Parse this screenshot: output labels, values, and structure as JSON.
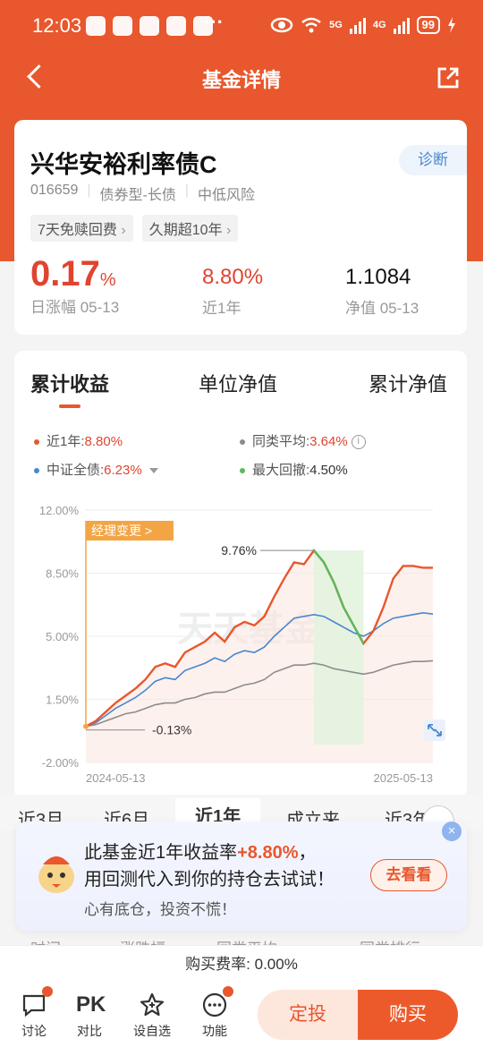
{
  "status": {
    "time": "12:03",
    "battery": "99",
    "net1": "5G",
    "net2": "4G",
    "more": "···"
  },
  "nav": {
    "title": "基金详情"
  },
  "fund": {
    "name": "兴华安裕利率债C",
    "code": "016659",
    "type": "债券型-长债",
    "risk": "中低风险",
    "diagnose": "诊断",
    "tags": [
      "7天免赎回费",
      "久期超10年"
    ],
    "day_change": "0.17",
    "day_change_unit": "%",
    "day_change_label": "日涨幅 05-13",
    "year_return": "8.80%",
    "year_return_label": "近1年",
    "nav_value": "1.1084",
    "nav_label": "净值 05-13"
  },
  "chart_tabs": [
    "累计收益",
    "单位净值",
    "累计净值"
  ],
  "legend": {
    "fund_label": "近1年:",
    "fund_value": "8.80%",
    "avg_label": "同类平均:",
    "avg_value": "3.64%",
    "index_label": "中证全债:",
    "index_value": "6.23%",
    "drawdown_label": "最大回撤:",
    "drawdown_value": "4.50%"
  },
  "chart_data": {
    "type": "line",
    "y_ticks": [
      "12.00%",
      "8.50%",
      "5.00%",
      "1.50%",
      "-2.00%"
    ],
    "ylim": [
      -2.0,
      12.0
    ],
    "x_ticks": [
      "2024-05-13",
      "2025-05-13"
    ],
    "watermark": "天天基金",
    "annotation_manager": "经理变更 >",
    "annotation_max": "9.76%",
    "annotation_min": "-0.13%",
    "series": [
      {
        "values": [
          0.0,
          0.3,
          0.8,
          1.3,
          1.7,
          2.1,
          2.6,
          3.3,
          3.5,
          3.3,
          4.1,
          4.4,
          4.7,
          5.2,
          4.7,
          5.5,
          5.8,
          5.6,
          6.1,
          7.2,
          8.2,
          9.1,
          9.0,
          9.76,
          9.1,
          8.0,
          6.6,
          5.6,
          4.6,
          5.3,
          6.6,
          8.2,
          8.9,
          8.9,
          8.8,
          8.8
        ]
      },
      {
        "values": [
          0.0,
          0.2,
          0.6,
          1.0,
          1.3,
          1.6,
          2.0,
          2.5,
          2.7,
          2.6,
          3.1,
          3.3,
          3.5,
          3.8,
          3.6,
          4.0,
          4.2,
          4.1,
          4.4,
          5.0,
          5.5,
          6.0,
          6.1,
          6.2,
          6.1,
          5.8,
          5.5,
          5.2,
          5.0,
          5.3,
          5.7,
          6.0,
          6.1,
          6.2,
          6.3,
          6.23
        ]
      },
      {
        "values": [
          0.0,
          0.1,
          0.3,
          0.5,
          0.7,
          0.8,
          1.0,
          1.2,
          1.3,
          1.3,
          1.5,
          1.6,
          1.8,
          1.9,
          1.9,
          2.1,
          2.3,
          2.4,
          2.6,
          3.0,
          3.2,
          3.4,
          3.4,
          3.5,
          3.4,
          3.2,
          3.1,
          3.0,
          2.9,
          3.0,
          3.2,
          3.4,
          3.5,
          3.6,
          3.6,
          3.64
        ]
      }
    ],
    "colors": {
      "fund": "#e8572d",
      "index": "#4a86cf",
      "avg": "#8c8c8c",
      "drawdown": "#5cb85c"
    }
  },
  "period_tabs": [
    "近3月",
    "近6月",
    "近1年",
    "成立来",
    "近3年"
  ],
  "promo": {
    "line1_pre": "此基金近1年收益率",
    "line1_value": "+8.80%",
    "line1_post": "，",
    "line2": "用回测代入到你的持仓去试试！",
    "line3": "心有底仓，投资不慌！",
    "button": "去看看",
    "close": "×"
  },
  "table_headers": [
    "时间",
    "涨跌幅",
    "同类平均",
    "同类排行"
  ],
  "fee": "购买费率: 0.00%",
  "bottom": {
    "discuss": "讨论",
    "compare_icon": "PK",
    "compare": "对比",
    "watch": "设自选",
    "more": "功能",
    "fixed": "定投",
    "buy": "购买"
  }
}
